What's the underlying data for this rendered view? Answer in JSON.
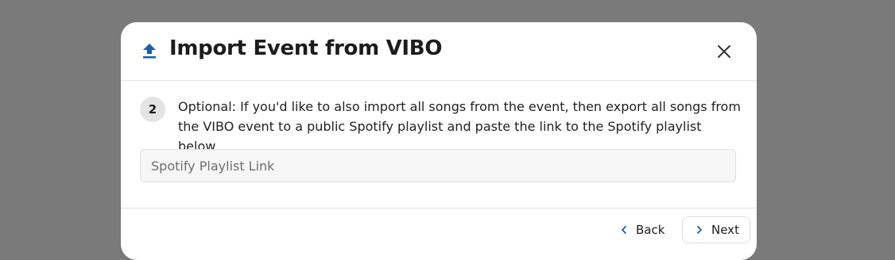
{
  "dialog": {
    "title": "Import Event from VIBO",
    "close_icon": "close-icon",
    "title_icon": "upload-icon",
    "accent_color": "#1d5fa0"
  },
  "step": {
    "number": "2",
    "text": "Optional: If you'd like to also import all songs from the event, then export all songs from the VIBO event to a public Spotify playlist and paste the link to the Spotify playlist below."
  },
  "playlist_input": {
    "placeholder": "Spotify Playlist Link",
    "value": ""
  },
  "footer": {
    "back_label": "Back",
    "next_label": "Next",
    "back_icon": "chevron-left-icon",
    "next_icon": "chevron-right-icon"
  }
}
